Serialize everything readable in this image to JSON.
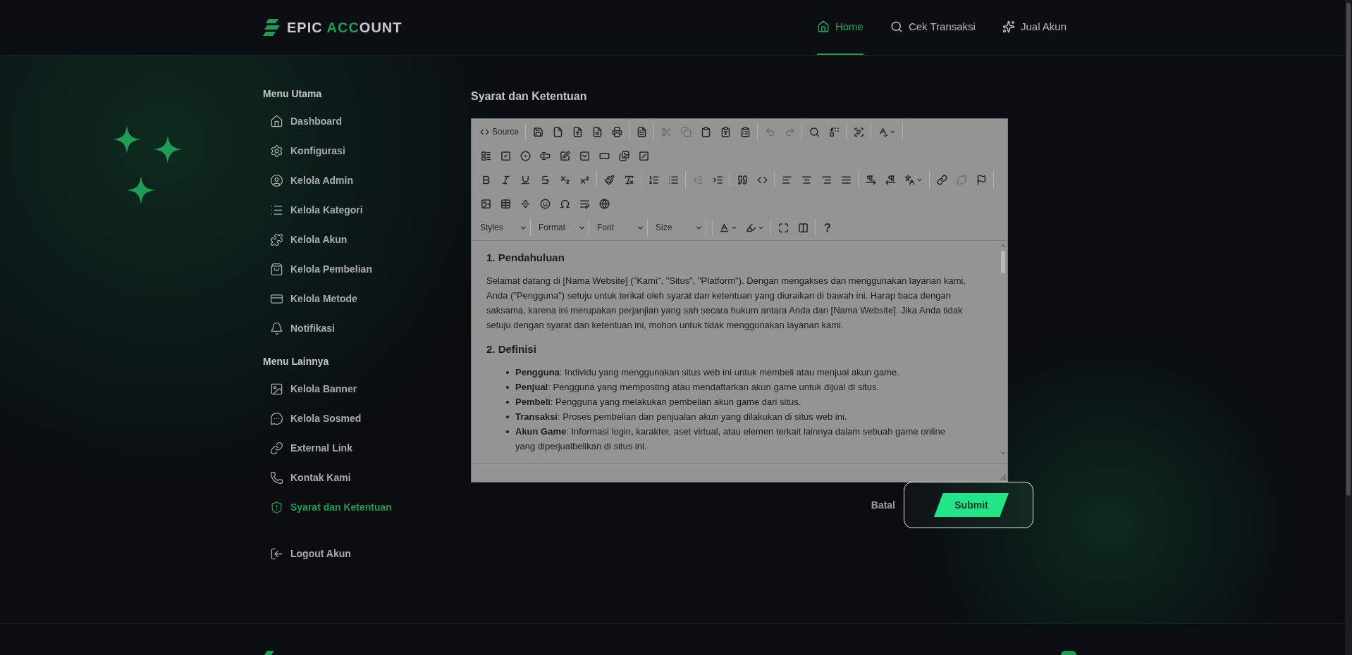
{
  "header": {
    "logo": [
      {
        "text": "EPIC ",
        "accent": false
      },
      {
        "text": "ACC",
        "accent": true
      },
      {
        "text": "OUNT",
        "accent": false
      }
    ],
    "nav": [
      {
        "label": "Home",
        "selected": true
      },
      {
        "label": "Cek Transaksi",
        "selected": false
      },
      {
        "label": "Jual Akun",
        "selected": false
      }
    ]
  },
  "sidebar": {
    "sections": [
      {
        "title": "Menu Utama",
        "items": [
          {
            "label": "Dashboard",
            "selected": false
          },
          {
            "label": "Konfigurasi",
            "selected": false
          },
          {
            "label": "Kelola Admin",
            "selected": false
          },
          {
            "label": "Kelola Kategori",
            "selected": false
          },
          {
            "label": "Kelola Akun",
            "selected": false
          },
          {
            "label": "Kelola Pembelian",
            "selected": false
          },
          {
            "label": "Kelola Metode",
            "selected": false
          },
          {
            "label": "Notifikasi",
            "selected": false
          }
        ]
      },
      {
        "title": "Menu Lainnya",
        "items": [
          {
            "label": "Kelola Banner",
            "selected": false
          },
          {
            "label": "Kelola Sosmed",
            "selected": false
          },
          {
            "label": "External Link",
            "selected": false
          },
          {
            "label": "Kontak Kami",
            "selected": false
          },
          {
            "label": "Syarat dan Ketentuan",
            "selected": true
          }
        ]
      }
    ],
    "logout": {
      "label": "Logout Akun"
    }
  },
  "page_title": "Syarat dan Ketentuan",
  "editor": {
    "toolbar": [
      [
        [
          {
            "kind": "source",
            "label": "Source",
            "disabled": false
          }
        ],
        [
          {
            "kind": "save",
            "disabled": false
          },
          {
            "kind": "newpage",
            "disabled": false
          },
          {
            "kind": "pdf",
            "disabled": false
          },
          {
            "kind": "preview",
            "disabled": false
          },
          {
            "kind": "print",
            "disabled": false
          }
        ],
        [
          {
            "kind": "templates",
            "disabled": false
          }
        ],
        [
          {
            "kind": "cut",
            "disabled": true
          },
          {
            "kind": "copy",
            "disabled": true
          },
          {
            "kind": "paste",
            "disabled": false
          },
          {
            "kind": "pastetext",
            "disabled": false
          },
          {
            "kind": "pasteword",
            "disabled": false
          }
        ],
        [
          {
            "kind": "undo",
            "disabled": true
          },
          {
            "kind": "redo",
            "disabled": true
          }
        ],
        [
          {
            "kind": "find",
            "disabled": false
          },
          {
            "kind": "replace",
            "disabled": false
          }
        ],
        [
          {
            "kind": "selectall",
            "disabled": false
          }
        ],
        [
          {
            "kind": "spellcheck",
            "disabled": false
          }
        ]
      ],
      [
        [
          {
            "kind": "form",
            "disabled": false
          },
          {
            "kind": "checkbox",
            "disabled": false
          },
          {
            "kind": "radio",
            "disabled": false
          },
          {
            "kind": "textfield",
            "disabled": false
          },
          {
            "kind": "textarea",
            "disabled": false
          },
          {
            "kind": "select",
            "disabled": false
          },
          {
            "kind": "formbutton",
            "disabled": false
          },
          {
            "kind": "imagebutton",
            "disabled": false
          },
          {
            "kind": "hiddenfield",
            "disabled": false
          }
        ]
      ],
      [
        [
          {
            "kind": "bold",
            "disabled": false
          },
          {
            "kind": "italic",
            "disabled": false
          },
          {
            "kind": "underline",
            "disabled": false
          },
          {
            "kind": "strike",
            "disabled": false
          },
          {
            "kind": "subscript",
            "disabled": false
          },
          {
            "kind": "superscript",
            "disabled": false
          }
        ],
        [
          {
            "kind": "copyformat",
            "disabled": false
          },
          {
            "kind": "removeformat",
            "disabled": false
          }
        ],
        [
          {
            "kind": "numlist",
            "disabled": false
          },
          {
            "kind": "bullist",
            "disabled": false
          }
        ],
        [
          {
            "kind": "outdent",
            "disabled": true
          },
          {
            "kind": "indent",
            "disabled": false
          }
        ],
        [
          {
            "kind": "blockquote",
            "disabled": false
          },
          {
            "kind": "creatediv",
            "disabled": false
          }
        ],
        [
          {
            "kind": "alignleft",
            "disabled": false
          },
          {
            "kind": "aligncenter",
            "disabled": false
          },
          {
            "kind": "alignright",
            "disabled": false
          },
          {
            "kind": "justify",
            "disabled": false
          }
        ],
        [
          {
            "kind": "ltr",
            "disabled": false
          },
          {
            "kind": "rtl",
            "disabled": false
          },
          {
            "kind": "language",
            "disabled": false
          }
        ],
        [
          {
            "kind": "link",
            "disabled": false
          },
          {
            "kind": "unlink",
            "disabled": true
          },
          {
            "kind": "anchor",
            "disabled": false
          }
        ]
      ],
      [
        [
          {
            "kind": "image",
            "disabled": false
          },
          {
            "kind": "table",
            "disabled": false
          },
          {
            "kind": "hr",
            "disabled": false
          },
          {
            "kind": "smiley",
            "disabled": false
          },
          {
            "kind": "specialchar",
            "disabled": false
          },
          {
            "kind": "pagebreak",
            "disabled": false
          },
          {
            "kind": "iframe",
            "disabled": false
          }
        ]
      ],
      [
        [
          {
            "kind": "combo",
            "label": "Styles",
            "disabled": false
          },
          {
            "kind": "combo",
            "label": "Format",
            "disabled": false
          },
          {
            "kind": "combo",
            "label": "Font",
            "disabled": false
          },
          {
            "kind": "combo",
            "label": "Size",
            "disabled": false
          }
        ],
        [
          {
            "kind": "textcolor",
            "disabled": false
          },
          {
            "kind": "bgcolor",
            "disabled": false
          }
        ],
        [
          {
            "kind": "maximize",
            "disabled": false
          },
          {
            "kind": "showblocks",
            "disabled": false
          }
        ],
        [
          {
            "kind": "help",
            "label": "?",
            "disabled": false
          }
        ]
      ]
    ],
    "content": [
      {
        "kind": "heading",
        "text": "1. Pendahuluan"
      },
      {
        "kind": "paragraph",
        "text": "Selamat datang di [Nama Website] (\"Kami\", \"Situs\", \"Platform\"). Dengan mengakses dan menggunakan layanan kami, Anda (\"Pengguna\") setuju untuk terikat oleh syarat dan ketentuan yang diuraikan di bawah ini. Harap baca dengan saksama, karena ini merupakan perjanjian yang sah secara hukum antara Anda dan [Nama Website]. Jika Anda tidak setuju dengan syarat dan ketentuan ini, mohon untuk tidak menggunakan layanan kami."
      },
      {
        "kind": "heading",
        "text": "2. Definisi"
      },
      {
        "kind": "list",
        "items": [
          "**Pengguna**: Individu yang menggunakan situs web ini untuk membeli atau menjual akun game.",
          "**Penjual**: Pengguna yang memposting atau mendaftarkan akun game untuk dijual di situs.",
          "**Pembeli**: Pengguna yang melakukan pembelian akun game dari situs.",
          "**Transaksi**: Proses pembelian dan penjualan akun yang dilakukan di situs web ini.",
          "**Akun Game**: Informasi login, karakter, aset virtual, atau elemen terkait lainnya dalam sebuah game online yang diperjualbelikan di situs ini."
        ]
      }
    ]
  },
  "actions": {
    "cancel": "Batal",
    "submit": "Submit"
  }
}
